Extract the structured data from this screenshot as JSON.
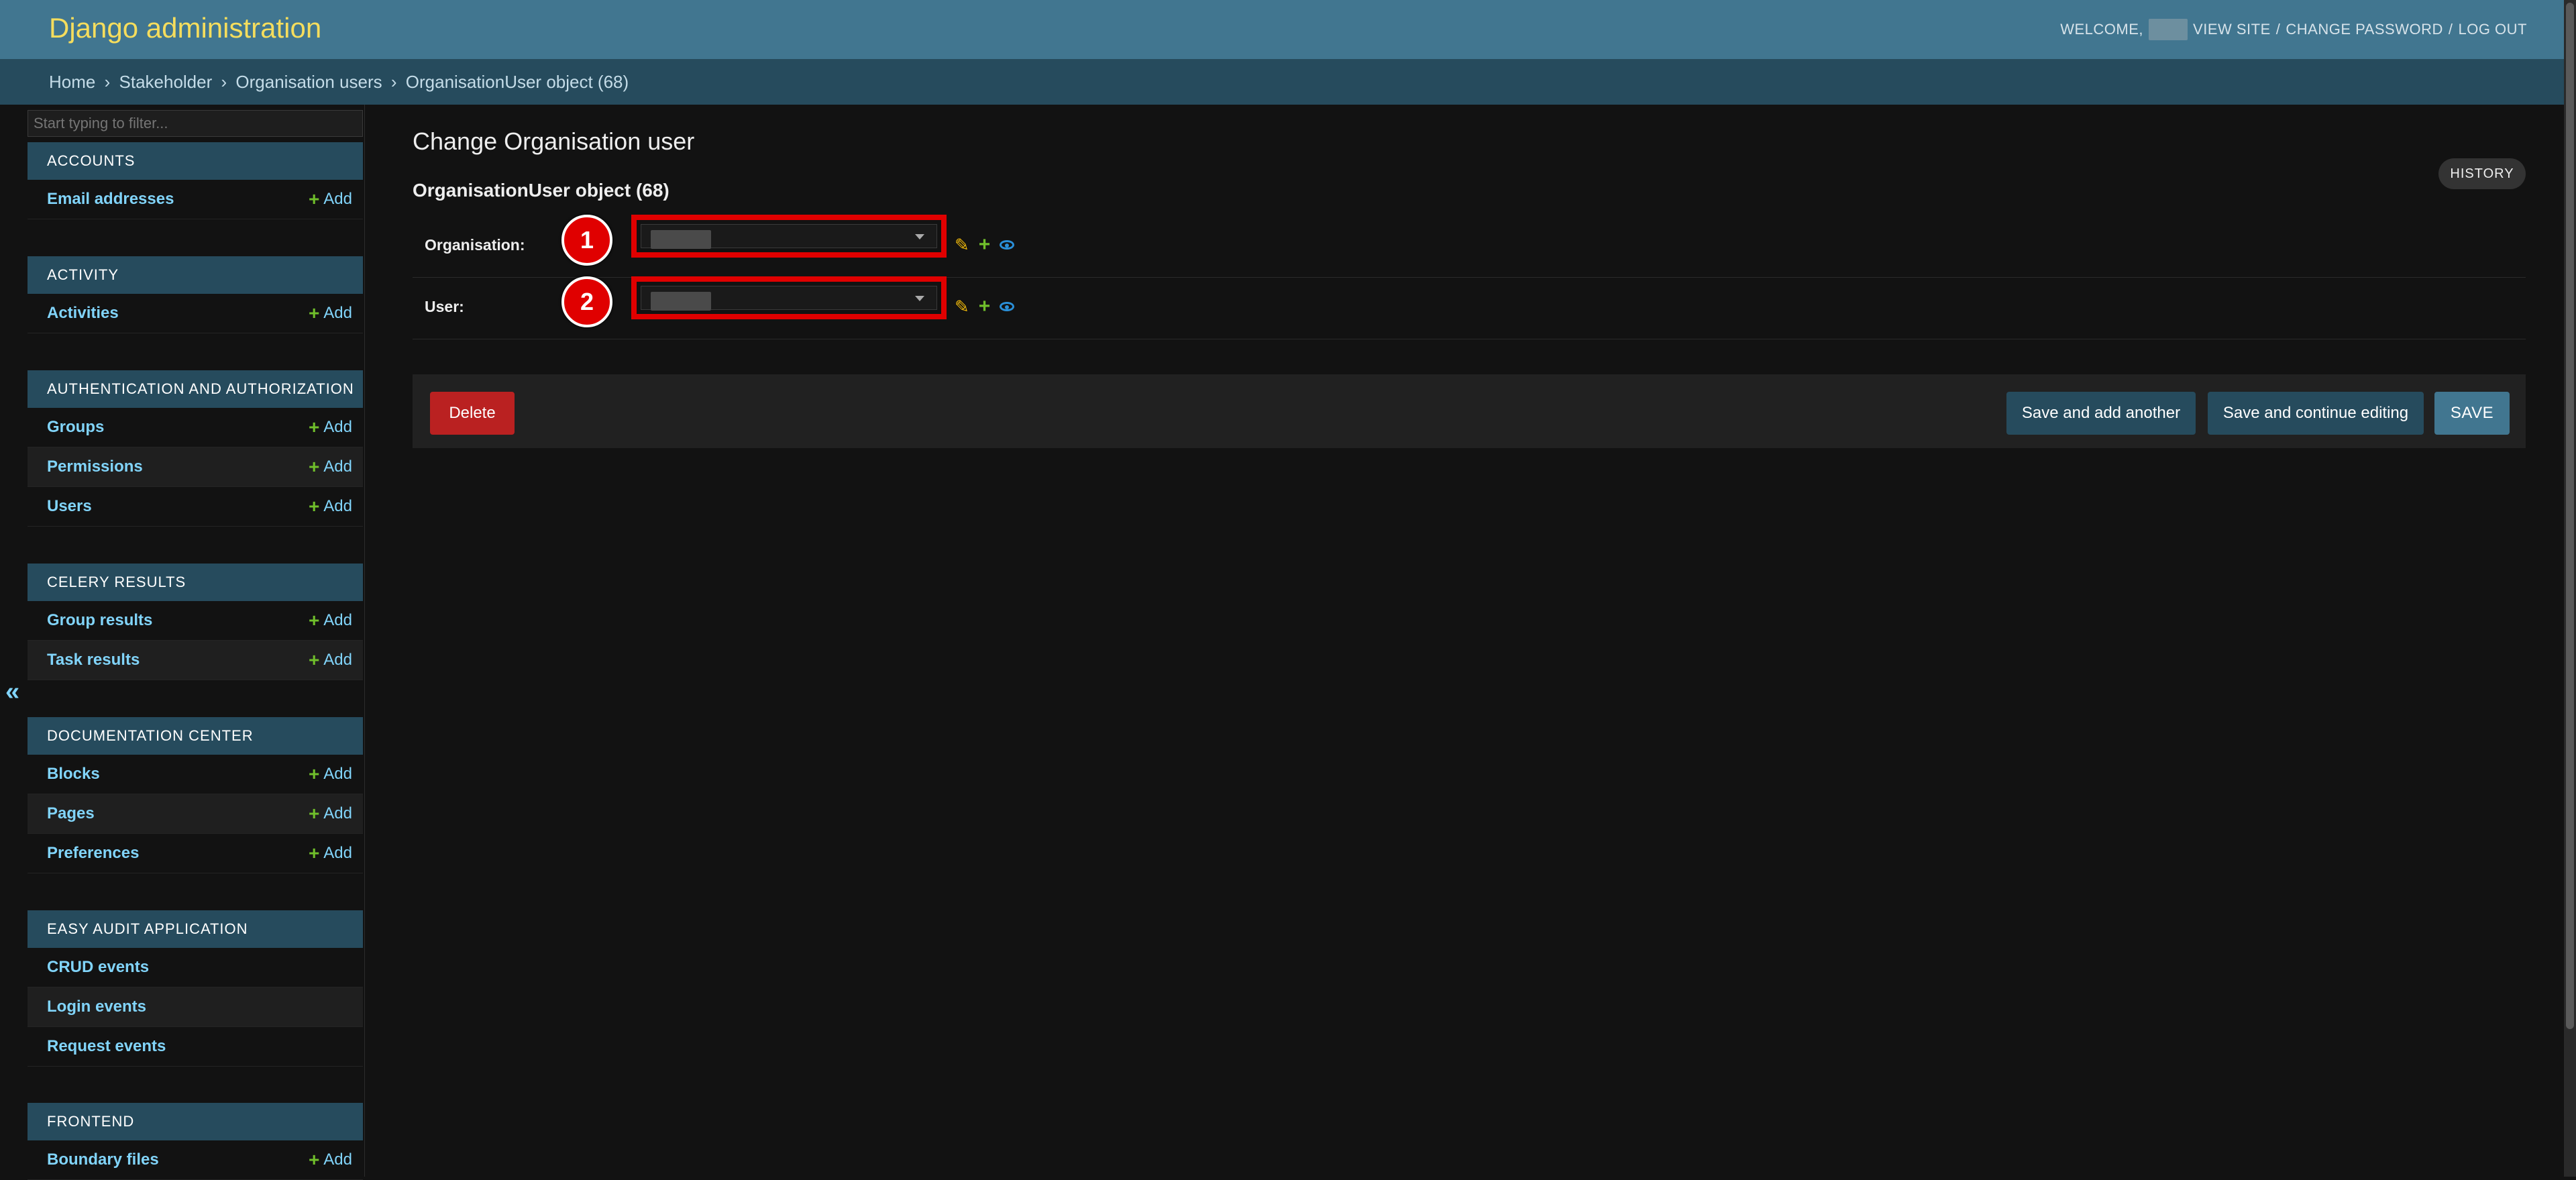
{
  "header": {
    "branding": "Django administration",
    "welcome": "WELCOME,",
    "view_site": "VIEW SITE",
    "change_password": "CHANGE PASSWORD",
    "log_out": "LOG OUT",
    "sep": "/"
  },
  "breadcrumbs": [
    "Home",
    "Stakeholder",
    "Organisation users",
    "OrganisationUser object (68)"
  ],
  "breadcrumb_sep": "›",
  "sidebar": {
    "filter_placeholder": "Start typing to filter...",
    "collapse_glyph": "«",
    "modules": [
      {
        "caption": "ACCOUNTS",
        "models": [
          {
            "name": "Email addresses",
            "add": "Add"
          }
        ]
      },
      {
        "caption": "ACTIVITY",
        "models": [
          {
            "name": "Activities",
            "add": "Add"
          }
        ]
      },
      {
        "caption": "AUTHENTICATION AND AUTHORIZATION",
        "models": [
          {
            "name": "Groups",
            "add": "Add"
          },
          {
            "name": "Permissions",
            "add": "Add"
          },
          {
            "name": "Users",
            "add": "Add"
          }
        ]
      },
      {
        "caption": "CELERY RESULTS",
        "models": [
          {
            "name": "Group results",
            "add": "Add"
          },
          {
            "name": "Task results",
            "add": "Add"
          }
        ]
      },
      {
        "caption": "DOCUMENTATION CENTER",
        "models": [
          {
            "name": "Blocks",
            "add": "Add"
          },
          {
            "name": "Pages",
            "add": "Add"
          },
          {
            "name": "Preferences",
            "add": "Add"
          }
        ]
      },
      {
        "caption": "EASY AUDIT APPLICATION",
        "models": [
          {
            "name": "CRUD events",
            "add": ""
          },
          {
            "name": "Login events",
            "add": ""
          },
          {
            "name": "Request events",
            "add": ""
          }
        ]
      },
      {
        "caption": "FRONTEND",
        "models": [
          {
            "name": "Boundary files",
            "add": "Add"
          }
        ]
      }
    ]
  },
  "content": {
    "page_title": "Change Organisation user",
    "history": "HISTORY",
    "object_title": "OrganisationUser object (68)",
    "fields": [
      {
        "label": "Organisation:",
        "badge": "1"
      },
      {
        "label": "User:",
        "badge": "2"
      }
    ]
  },
  "submit": {
    "delete": "Delete",
    "save_add_another": "Save and add another",
    "save_continue": "Save and continue editing",
    "save": "SAVE"
  },
  "colors": {
    "header_bg": "#417690",
    "breadcrumb_bg": "#264b5d",
    "branding": "#f5dd5d",
    "link": "#81d4fa",
    "add_plus": "#70bf2b",
    "delete": "#ba2121",
    "annotation": "#e00000"
  }
}
